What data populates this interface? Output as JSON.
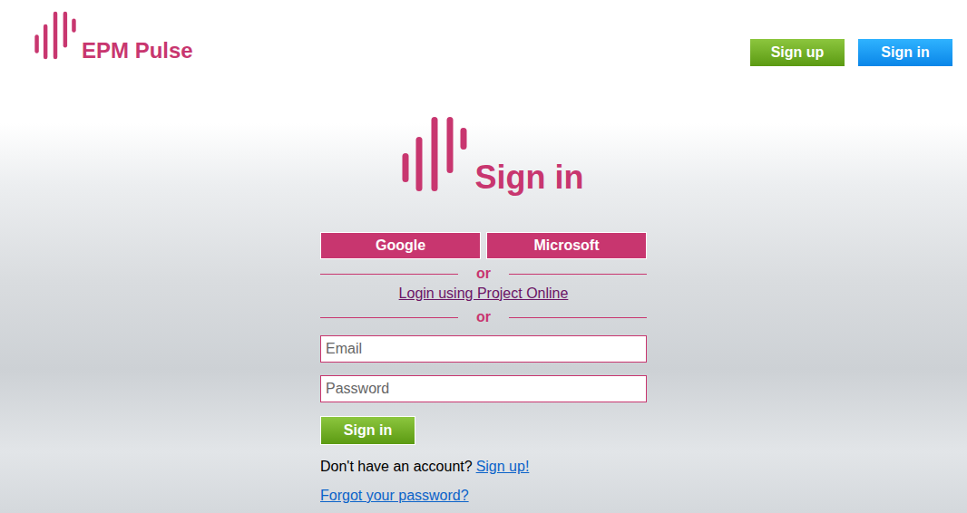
{
  "header": {
    "brand": "EPM Pulse",
    "buttons": [
      {
        "label": "Sign up",
        "kind": "signup"
      },
      {
        "label": "Sign in",
        "kind": "signin"
      }
    ]
  },
  "form": {
    "title": "Sign in",
    "providers": [
      "Google",
      "Microsoft"
    ],
    "separator_top": "or",
    "project_online_link": "Login using Project Online",
    "separator_bottom": "or",
    "fields": [
      {
        "placeholder": "Email",
        "kind": "email"
      },
      {
        "placeholder": "Password",
        "kind": "password"
      }
    ],
    "submit": "Sign in",
    "signup_prompt": "Don't have an account?",
    "signup_link": "Sign up!",
    "forgot_link": "Forgot your password?"
  }
}
